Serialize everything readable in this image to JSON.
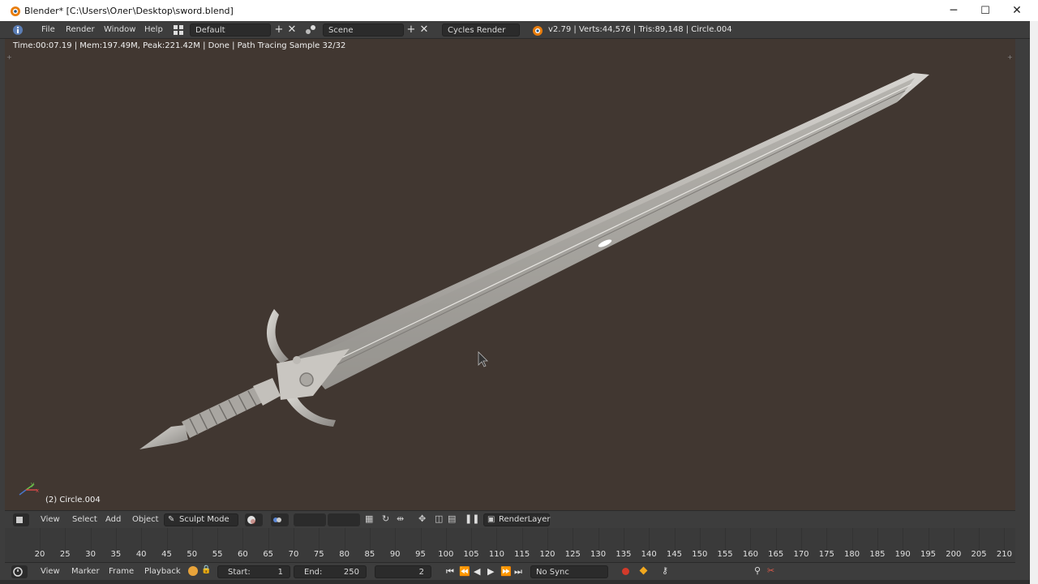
{
  "window": {
    "title": "Blender* [C:\\Users\\Олег\\Desktop\\sword.blend]",
    "minimize": "─",
    "maximize": "☐",
    "close": "✕"
  },
  "info_header": {
    "menus": [
      "File",
      "Render",
      "Window",
      "Help"
    ],
    "layout": "Default",
    "scene": "Scene",
    "engine": "Cycles Render",
    "stats": "v2.79 | Verts:44,576 | Tris:89,148 | Circle.004"
  },
  "viewport": {
    "render_status": "Time:00:07.19 | Mem:197.49M, Peak:221.42M | Done | Path Tracing Sample 32/32",
    "object_label": "(2) Circle.004",
    "axis_x": "x",
    "axis_y": "y"
  },
  "view3d_header": {
    "menus": [
      "View",
      "Select",
      "Add",
      "Object"
    ],
    "mode": "Sculpt Mode",
    "render_layer": "RenderLayer"
  },
  "timeline": {
    "frames": [
      "20",
      "25",
      "30",
      "35",
      "40",
      "45",
      "50",
      "55",
      "60",
      "65",
      "70",
      "75",
      "80",
      "85",
      "90",
      "95",
      "100",
      "105",
      "110",
      "115",
      "120",
      "125",
      "130",
      "135",
      "140",
      "145",
      "150",
      "155",
      "160",
      "165",
      "170",
      "175",
      "180",
      "185",
      "190",
      "195",
      "200",
      "205",
      "210"
    ]
  },
  "timeline_header": {
    "menus": [
      "View",
      "Marker",
      "Frame",
      "Playback"
    ],
    "start_label": "Start:",
    "start_value": "1",
    "end_label": "End:",
    "end_value": "250",
    "current_frame": "2",
    "sync": "No Sync"
  },
  "colors": {
    "viewport_bg": "#413731",
    "header_bg": "#3d3d3d",
    "blade": "#b9b6b2"
  }
}
